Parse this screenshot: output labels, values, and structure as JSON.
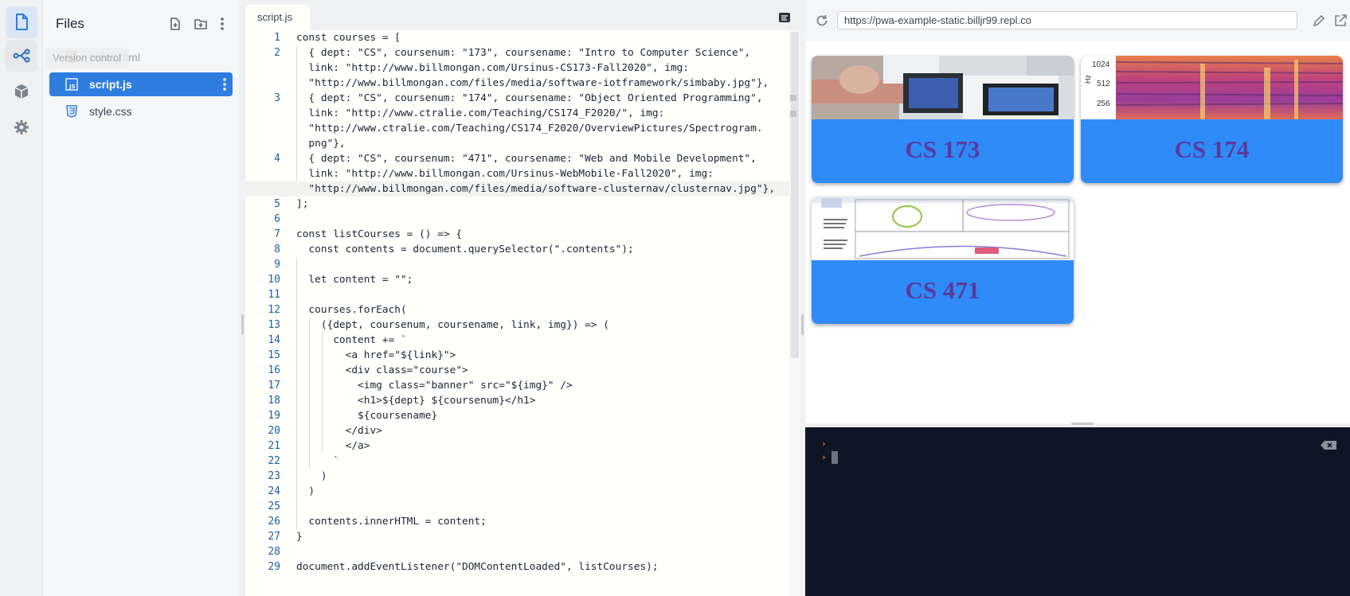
{
  "activity_bar": {
    "items": [
      "files-icon",
      "version-control-icon",
      "packages-icon",
      "settings-icon"
    ],
    "tooltip": "Version control"
  },
  "files_panel": {
    "title": "Files",
    "files": [
      {
        "name": "index.html",
        "type": "html"
      },
      {
        "name": "script.js",
        "type": "js",
        "selected": true
      },
      {
        "name": "style.css",
        "type": "css"
      }
    ]
  },
  "editor": {
    "tab_label": "script.js",
    "line_numbers": [
      "1",
      "2",
      "3",
      "4",
      "5",
      "6",
      "7",
      "8",
      "9",
      "10",
      "11",
      "12",
      "13",
      "14",
      "15",
      "16",
      "17",
      "18",
      "19",
      "20",
      "21",
      "22",
      "23",
      "24",
      "25",
      "26",
      "27",
      "28",
      "29"
    ],
    "lines": [
      "const courses = [",
      "  { dept: \"CS\", coursenum: \"173\", coursename: \"Intro to Computer Science\",",
      "  link: \"http://www.billmongan.com/Ursinus-CS173-Fall2020\", img:",
      "  \"http://www.billmongan.com/files/media/software-iotframework/simbaby.jpg\"},",
      "  { dept: \"CS\", coursenum: \"174\", coursename: \"Object Oriented Programming\",",
      "  link: \"http://www.ctralie.com/Teaching/CS174_F2020/\", img:",
      "  \"http://www.ctralie.com/Teaching/CS174_F2020/OverviewPictures/Spectrogram.",
      "  png\"},",
      "  { dept: \"CS\", coursenum: \"471\", coursename: \"Web and Mobile Development\",",
      "  link: \"http://www.billmongan.com/Ursinus-WebMobile-Fall2020\", img:",
      "  \"http://www.billmongan.com/files/media/software-clusternav/clusternav.jpg\"},",
      "];",
      "",
      "const listCourses = () => {",
      "  const contents = document.querySelector(\".contents\");",
      "",
      "  let content = \"\";",
      "",
      "  courses.forEach(",
      "    ({dept, coursenum, coursename, link, img}) => (",
      "      content += `",
      "        <a href=\"${link}\">",
      "        <div class=\"course\">",
      "          <img class=\"banner\" src=\"${img}\" />",
      "          <h1>${dept} ${coursenum}</h1>",
      "          ${coursename}",
      "        </div>",
      "        </a>",
      "      `",
      "    )",
      "  )",
      "",
      "  contents.innerHTML = content;",
      "}",
      "",
      "document.addEventListener(\"DOMContentLoaded\", listCourses);"
    ]
  },
  "preview": {
    "url": "https://pwa-example-static.billjr99.repl.co",
    "cards": [
      {
        "title": "CS 173"
      },
      {
        "title": "CS 174"
      },
      {
        "title": "CS 471"
      }
    ],
    "spectrogram_ticks": [
      "1024",
      "512",
      "256"
    ],
    "spectrogram_axis": "Hz"
  },
  "console": {
    "prompts": [
      "›",
      "›"
    ]
  },
  "colors": {
    "accent": "#2f7de1",
    "card_bg": "#2f8bf8",
    "card_title": "#5a3a9c",
    "console_bg": "#0e1525"
  }
}
